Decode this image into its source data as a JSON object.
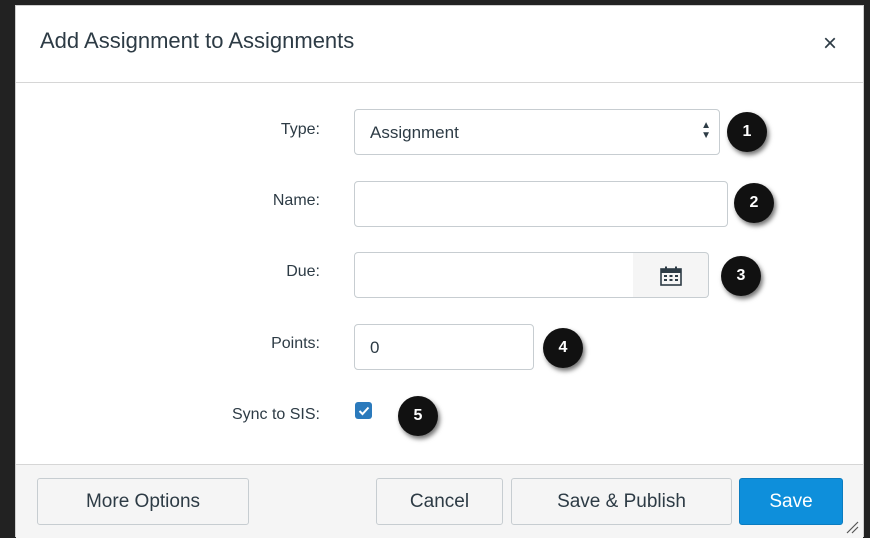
{
  "dialog": {
    "title": "Add Assignment to Assignments",
    "close_icon": "close-icon"
  },
  "form": {
    "type": {
      "label": "Type:",
      "value": "Assignment",
      "badge": "1"
    },
    "name": {
      "label": "Name:",
      "value": "",
      "badge": "2"
    },
    "due": {
      "label": "Due:",
      "value": "",
      "badge": "3",
      "icon": "calendar-icon"
    },
    "points": {
      "label": "Points:",
      "value": "0",
      "badge": "4"
    },
    "sync": {
      "label": "Sync to SIS:",
      "checked": true,
      "badge": "5"
    }
  },
  "footer": {
    "more_options": "More Options",
    "cancel": "Cancel",
    "save_publish": "Save & Publish",
    "save": "Save"
  },
  "colors": {
    "primary": "#0e8fdb",
    "checkbox": "#2b7abc",
    "text": "#2d3b45",
    "badge": "#111111"
  }
}
